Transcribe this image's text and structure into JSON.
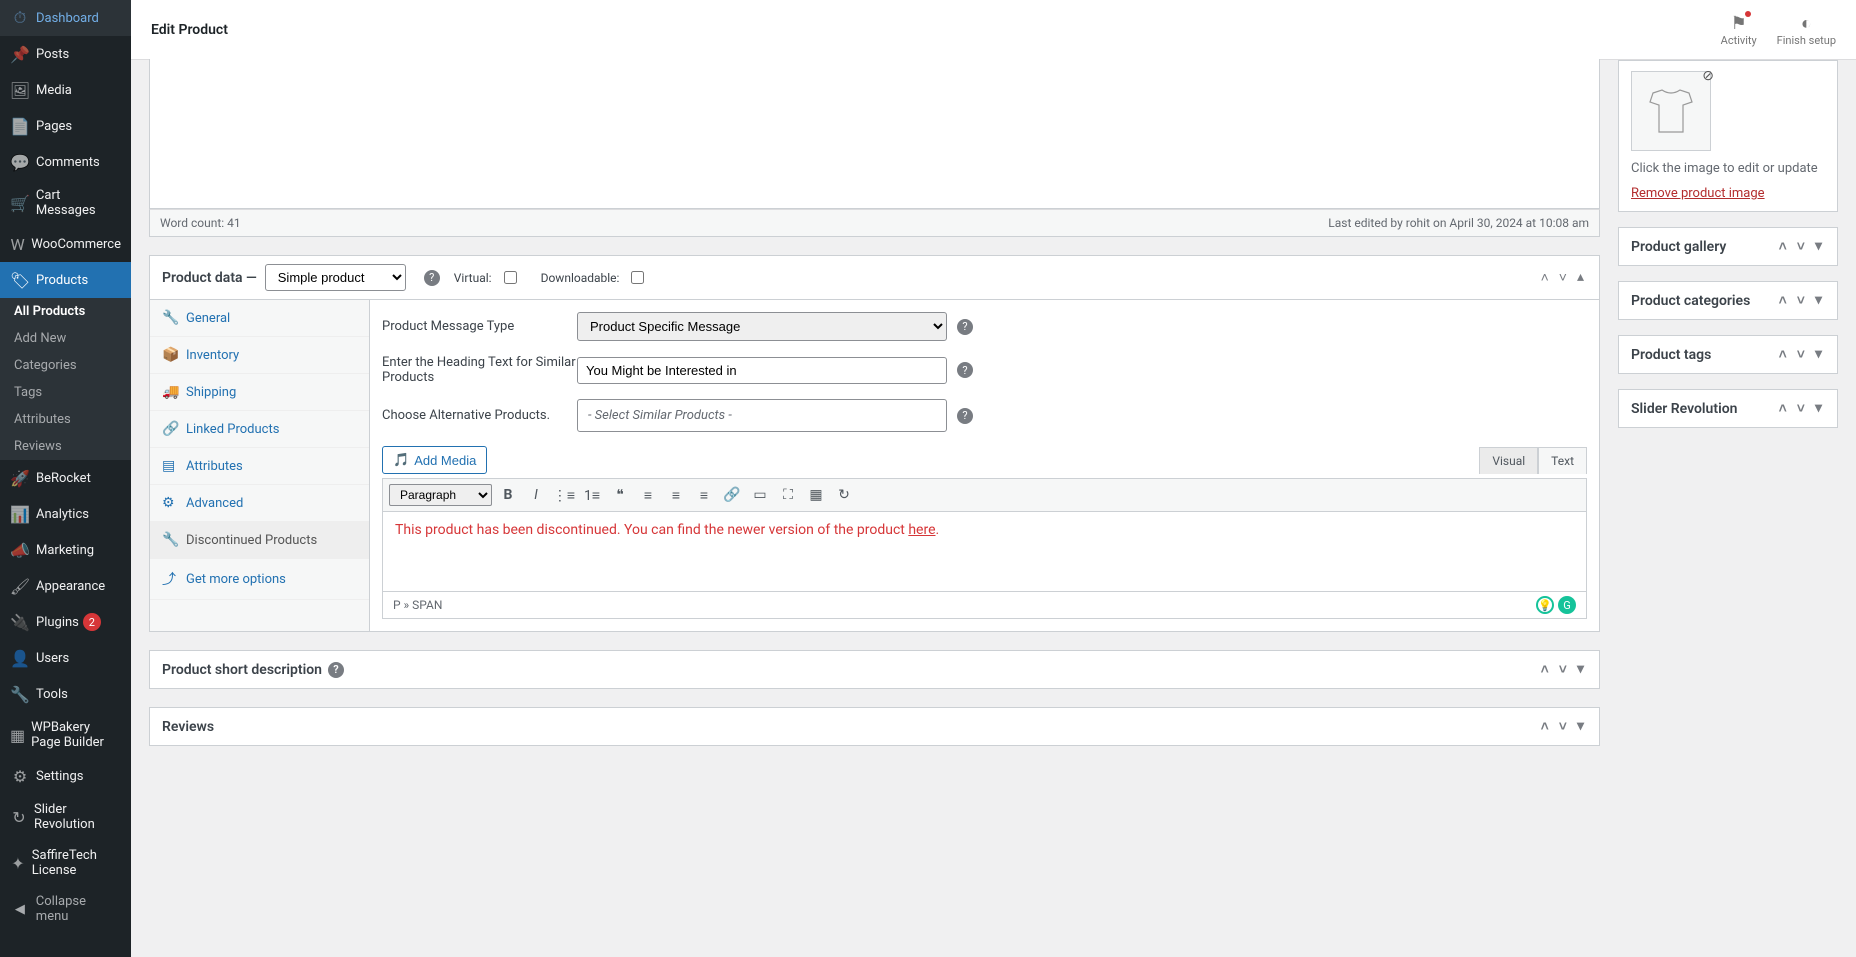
{
  "topbar": {
    "title": "Edit Product",
    "activity": "Activity",
    "finish": "Finish setup"
  },
  "sidebar": {
    "items": [
      {
        "icon": "⏱",
        "label": "Dashboard"
      },
      {
        "icon": "📌",
        "label": "Posts"
      },
      {
        "icon": "🖼",
        "label": "Media"
      },
      {
        "icon": "📄",
        "label": "Pages"
      },
      {
        "icon": "💬",
        "label": "Comments"
      },
      {
        "icon": "🛒",
        "label": "Cart Messages"
      },
      {
        "icon": "W",
        "label": "WooCommerce"
      },
      {
        "icon": "🏷",
        "label": "Products"
      },
      {
        "icon": "🚀",
        "label": "BeRocket"
      },
      {
        "icon": "📊",
        "label": "Analytics"
      },
      {
        "icon": "📣",
        "label": "Marketing"
      },
      {
        "icon": "🖌",
        "label": "Appearance"
      },
      {
        "icon": "🔌",
        "label": "Plugins"
      },
      {
        "icon": "👤",
        "label": "Users"
      },
      {
        "icon": "🔧",
        "label": "Tools"
      },
      {
        "icon": "▦",
        "label": "WPBakery Page Builder"
      },
      {
        "icon": "⚙",
        "label": "Settings"
      },
      {
        "icon": "↻",
        "label": "Slider Revolution"
      },
      {
        "icon": "✦",
        "label": "SaffireTech License"
      }
    ],
    "products_sub": [
      "All Products",
      "Add New",
      "Categories",
      "Tags",
      "Attributes",
      "Reviews"
    ],
    "plugins_badge": "2",
    "collapse": "Collapse menu"
  },
  "editor_footer": {
    "wordcount": "Word count: 41",
    "lastedit": "Last edited by rohit on April 30, 2024 at 10:08 am"
  },
  "product_data": {
    "title": "Product data —",
    "type_options": [
      "Simple product"
    ],
    "virtual_label": "Virtual:",
    "download_label": "Downloadable:",
    "tabs": [
      {
        "icon": "🔧",
        "label": "General"
      },
      {
        "icon": "📦",
        "label": "Inventory"
      },
      {
        "icon": "🚚",
        "label": "Shipping"
      },
      {
        "icon": "🔗",
        "label": "Linked Products"
      },
      {
        "icon": "▤",
        "label": "Attributes"
      },
      {
        "icon": "⚙",
        "label": "Advanced"
      },
      {
        "icon": "🔧",
        "label": "Discontinued Products"
      },
      {
        "icon": "⤴",
        "label": "Get more options"
      }
    ],
    "fields": {
      "msg_type_label": "Product Message Type",
      "msg_type_value": "Product Specific Message",
      "heading_label": "Enter the Heading Text for Similar Products",
      "heading_value": "You Might be Interested in",
      "alt_label": "Choose Alternative Products.",
      "alt_placeholder": "- Select Similar Products -"
    },
    "add_media": "Add Media",
    "rte_tabs": {
      "visual": "Visual",
      "text": "Text"
    },
    "paragraph": "Paragraph",
    "rte_text": "This product has been discontinued. You can find the newer version of the product ",
    "rte_link": "here",
    "rte_path": "P » SPAN"
  },
  "short_desc": {
    "title": "Product short description"
  },
  "reviews": {
    "title": "Reviews"
  },
  "side": {
    "image_hint": "Click the image to edit or update",
    "remove": "Remove product image",
    "gallery": "Product gallery",
    "categories": "Product categories",
    "tags": "Product tags",
    "slider": "Slider Revolution"
  }
}
